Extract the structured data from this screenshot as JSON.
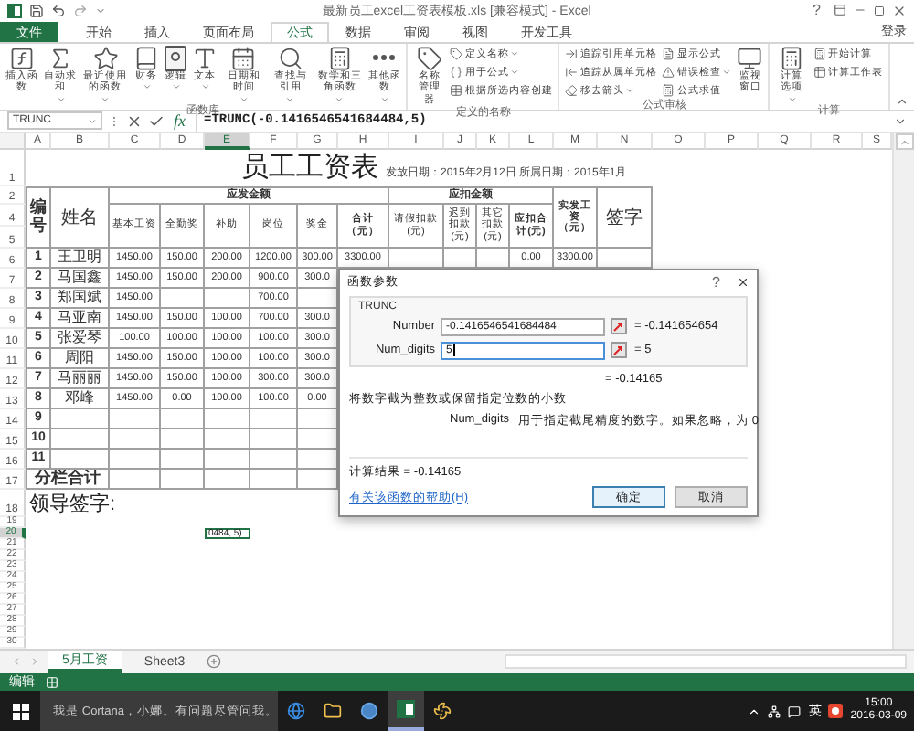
{
  "window": {
    "title": "最新员工excel工资表模板.xls  [兼容模式] - Excel",
    "help": "?"
  },
  "ribbon_tabs": [
    {
      "label": "文件",
      "kind": "file",
      "selected": false
    },
    {
      "label": "开始",
      "kind": "tab",
      "selected": false
    },
    {
      "label": "插入",
      "kind": "tab",
      "selected": false
    },
    {
      "label": "页面布局",
      "kind": "tab",
      "selected": false
    },
    {
      "label": "公式",
      "kind": "tab",
      "selected": true
    },
    {
      "label": "数据",
      "kind": "tab",
      "selected": false
    },
    {
      "label": "审阅",
      "kind": "tab",
      "selected": false
    },
    {
      "label": "视图",
      "kind": "tab",
      "selected": false
    },
    {
      "label": "开发工具",
      "kind": "tab",
      "selected": false
    }
  ],
  "account": "登录",
  "ribbon_groups": [
    {
      "label": "函数库",
      "items": [
        {
          "label": "插入函数",
          "kind": "large",
          "dropdown": false
        },
        {
          "label": "自动求和",
          "kind": "large",
          "dropdown": true
        },
        {
          "label": "最近使用的函数",
          "kind": "large",
          "dropdown": true
        },
        {
          "label": "财务",
          "kind": "large",
          "dropdown": true
        },
        {
          "label": "逻辑",
          "kind": "large",
          "dropdown": true
        },
        {
          "label": "文本",
          "kind": "large",
          "dropdown": true
        },
        {
          "label": "日期和时间",
          "kind": "large",
          "dropdown": true
        },
        {
          "label": "查找与引用",
          "kind": "large",
          "dropdown": true
        },
        {
          "label": "数学和三角函数",
          "kind": "large",
          "dropdown": true
        },
        {
          "label": "其他函数",
          "kind": "large",
          "dropdown": true
        }
      ]
    },
    {
      "label": "定义的名称",
      "items": [
        {
          "label": "名称管理器",
          "kind": "large",
          "dropdown": false
        },
        {
          "label": "定义名称",
          "kind": "small",
          "dropdown": true
        },
        {
          "label": "用于公式",
          "kind": "small",
          "dropdown": true
        },
        {
          "label": "根据所选内容创建",
          "kind": "small",
          "dropdown": false
        }
      ]
    },
    {
      "label": "公式审核",
      "items": [
        {
          "label": "追踪引用单元格",
          "kind": "small",
          "dropdown": false
        },
        {
          "label": "追踪从属单元格",
          "kind": "small",
          "dropdown": false
        },
        {
          "label": "移去箭头",
          "kind": "small",
          "dropdown": true
        },
        {
          "label": "显示公式",
          "kind": "small",
          "dropdown": false
        },
        {
          "label": "错误检查",
          "kind": "small",
          "dropdown": true
        },
        {
          "label": "公式求值",
          "kind": "small",
          "dropdown": false
        },
        {
          "label": "监视窗口",
          "kind": "large",
          "dropdown": false
        }
      ]
    },
    {
      "label": "计算",
      "items": [
        {
          "label": "计算选项",
          "kind": "large",
          "dropdown": true
        },
        {
          "label": "开始计算",
          "kind": "small",
          "dropdown": false
        },
        {
          "label": "计算工作表",
          "kind": "small",
          "dropdown": false
        }
      ]
    }
  ],
  "formula_bar": {
    "name_box": "TRUNC",
    "insert_function": "fx",
    "formula": "=TRUNC(-0.1416546541684484,5)"
  },
  "column_headers": [
    {
      "label": "A",
      "selected": false
    },
    {
      "label": "B",
      "selected": false
    },
    {
      "label": "C",
      "selected": false
    },
    {
      "label": "D",
      "selected": false
    },
    {
      "label": "E",
      "selected": true
    },
    {
      "label": "F",
      "selected": false
    },
    {
      "label": "G",
      "selected": false
    },
    {
      "label": "H",
      "selected": false
    },
    {
      "label": "I",
      "selected": false
    },
    {
      "label": "J",
      "selected": false
    },
    {
      "label": "K",
      "selected": false
    },
    {
      "label": "L",
      "selected": false
    },
    {
      "label": "M",
      "selected": false
    },
    {
      "label": "N",
      "selected": false
    },
    {
      "label": "O",
      "selected": false
    },
    {
      "label": "P",
      "selected": false
    },
    {
      "label": "Q",
      "selected": false
    },
    {
      "label": "R",
      "selected": false
    },
    {
      "label": "S",
      "selected": false
    }
  ],
  "row_headers": [
    {
      "label": "1",
      "selected": false
    },
    {
      "label": "2",
      "selected": false
    },
    {
      "label": "4",
      "selected": false
    },
    {
      "label": "5",
      "selected": false
    },
    {
      "label": "6",
      "selected": false
    },
    {
      "label": "7",
      "selected": false
    },
    {
      "label": "8",
      "selected": false
    },
    {
      "label": "9",
      "selected": false
    },
    {
      "label": "10",
      "selected": false
    },
    {
      "label": "11",
      "selected": false
    },
    {
      "label": "12",
      "selected": false
    },
    {
      "label": "13",
      "selected": false
    },
    {
      "label": "14",
      "selected": false
    },
    {
      "label": "15",
      "selected": false
    },
    {
      "label": "16",
      "selected": false
    },
    {
      "label": "17",
      "selected": false
    },
    {
      "label": "18",
      "selected": false
    },
    {
      "label": "19",
      "selected": false
    },
    {
      "label": "20",
      "selected": true
    },
    {
      "label": "21",
      "selected": false
    },
    {
      "label": "22",
      "selected": false
    },
    {
      "label": "23",
      "selected": false
    },
    {
      "label": "24",
      "selected": false
    },
    {
      "label": "25",
      "selected": false
    },
    {
      "label": "26",
      "selected": false
    },
    {
      "label": "27",
      "selected": false
    },
    {
      "label": "28",
      "selected": false
    },
    {
      "label": "29",
      "selected": false
    },
    {
      "label": "30",
      "selected": false
    }
  ],
  "sheet": {
    "title": "员工工资表",
    "dates": "发放日期：2015年2月12日 所属日期：2015年1月",
    "header": {
      "number": "编号",
      "name": "姓名",
      "gross": "应发金额",
      "gross_columns": [
        "基本工资",
        "全勤奖",
        "补助",
        "岗位",
        "奖金",
        "合计（元）"
      ],
      "deductions": "应扣金额",
      "deduction_columns": [
        "请假扣款(元)",
        "迟到扣款(元)",
        "其它扣款(元)",
        "应扣合计(元)"
      ],
      "net": "实发工资（元）",
      "signature": "签字"
    },
    "rows": [
      {
        "number": "1",
        "name": "王卫明",
        "cells": [
          {
            "kind": "value",
            "text": "1450.00"
          },
          {
            "kind": "value",
            "text": "150.00"
          },
          {
            "kind": "value",
            "text": "200.00"
          },
          {
            "kind": "value",
            "text": "1200.00"
          },
          {
            "kind": "value",
            "text": "300.00"
          },
          {
            "kind": "value",
            "text": "3300.00"
          },
          {
            "kind": "empty"
          },
          {
            "kind": "empty"
          },
          {
            "kind": "empty"
          },
          {
            "kind": "value",
            "text": "0.00"
          },
          {
            "kind": "value",
            "text": "3300.00"
          },
          {
            "kind": "empty"
          }
        ]
      },
      {
        "number": "2",
        "name": "马国鑫",
        "cells": [
          {
            "kind": "value",
            "text": "1450.00"
          },
          {
            "kind": "value",
            "text": "150.00"
          },
          {
            "kind": "value",
            "text": "200.00"
          },
          {
            "kind": "value",
            "text": "900.00"
          },
          {
            "kind": "value",
            "text": "300.0"
          }
        ]
      },
      {
        "number": "3",
        "name": "郑国斌",
        "cells": [
          {
            "kind": "value",
            "text": "1450.00"
          },
          {
            "kind": "empty"
          },
          {
            "kind": "empty"
          },
          {
            "kind": "value",
            "text": "700.00"
          },
          {
            "kind": "empty"
          }
        ]
      },
      {
        "number": "4",
        "name": "马亚南",
        "cells": [
          {
            "kind": "value",
            "text": "1450.00"
          },
          {
            "kind": "value",
            "text": "150.00"
          },
          {
            "kind": "value",
            "text": "100.00"
          },
          {
            "kind": "value",
            "text": "700.00"
          },
          {
            "kind": "value",
            "text": "300.0"
          }
        ]
      },
      {
        "number": "5",
        "name": "张爱琴",
        "cells": [
          {
            "kind": "value",
            "text": "100.00"
          },
          {
            "kind": "value",
            "text": "100.00"
          },
          {
            "kind": "value",
            "text": "100.00"
          },
          {
            "kind": "value",
            "text": "100.00"
          },
          {
            "kind": "value",
            "text": "300.0"
          }
        ]
      },
      {
        "number": "6",
        "name": "周阳",
        "cells": [
          {
            "kind": "value",
            "text": "1450.00"
          },
          {
            "kind": "value",
            "text": "150.00"
          },
          {
            "kind": "value",
            "text": "100.00"
          },
          {
            "kind": "value",
            "text": "100.00"
          },
          {
            "kind": "value",
            "text": "300.0"
          }
        ]
      },
      {
        "number": "7",
        "name": "马丽丽",
        "cells": [
          {
            "kind": "value",
            "text": "1450.00"
          },
          {
            "kind": "value",
            "text": "150.00"
          },
          {
            "kind": "value",
            "text": "100.00"
          },
          {
            "kind": "value",
            "text": "300.00"
          },
          {
            "kind": "value",
            "text": "300.0"
          }
        ]
      },
      {
        "number": "8",
        "name": "邓峰",
        "cells": [
          {
            "kind": "value",
            "text": "1450.00"
          },
          {
            "kind": "value",
            "text": "0.00"
          },
          {
            "kind": "value",
            "text": "100.00"
          },
          {
            "kind": "value",
            "text": "100.00"
          },
          {
            "kind": "value",
            "text": "0.00"
          }
        ]
      },
      {
        "number": "9",
        "cells": [
          {
            "kind": "empty"
          },
          {
            "kind": "empty"
          },
          {
            "kind": "empty"
          },
          {
            "kind": "empty"
          },
          {
            "kind": "empty"
          }
        ]
      },
      {
        "number": "10",
        "cells": [
          {
            "kind": "empty"
          },
          {
            "kind": "empty"
          },
          {
            "kind": "empty"
          },
          {
            "kind": "empty"
          },
          {
            "kind": "empty"
          }
        ]
      },
      {
        "number": "11",
        "cells": [
          {
            "kind": "empty"
          },
          {
            "kind": "empty"
          },
          {
            "kind": "empty"
          },
          {
            "kind": "empty"
          },
          {
            "kind": "empty"
          }
        ]
      }
    ],
    "subtotal": {
      "label": "分栏合计",
      "cells": [
        {
          "kind": "empty"
        },
        {
          "kind": "empty"
        },
        {
          "kind": "empty"
        },
        {
          "kind": "empty"
        },
        {
          "kind": "empty"
        }
      ]
    },
    "leader_signature": "领导签字:",
    "active_cell": "0484, 5)"
  },
  "dialog": {
    "title": "函数参数",
    "help": "?",
    "function": "TRUNC",
    "arguments": [
      {
        "label": "Number",
        "value": "-0.1416546541684484",
        "result": "=  -0.141654654",
        "focused": false
      },
      {
        "label": "Num_digits",
        "value": "5",
        "result": "=  5",
        "focused": true
      }
    ],
    "function_result": "=  -0.14165",
    "description": "将数字截为整数或保留指定位数的小数",
    "argument_help": {
      "label": "Num_digits",
      "text": "用于指定截尾精度的数字。如果忽略，为 0"
    },
    "formula_result": "计算结果 =  -0.14165",
    "help_link": "有关该函数的帮助(H)",
    "buttons": [
      {
        "label": "确定",
        "default": true
      },
      {
        "label": "取消",
        "default": false
      }
    ]
  },
  "sheet_tabs": [
    {
      "label": "5月工资",
      "selected": true
    },
    {
      "label": "Sheet3",
      "selected": false
    }
  ],
  "status_bar": {
    "mode": "编辑"
  },
  "taskbar": {
    "search_placeholder": "我是 Cortana，小娜。有问题尽管问我。",
    "input_method": "英",
    "time": "15:00",
    "date": "2016-03-09"
  }
}
